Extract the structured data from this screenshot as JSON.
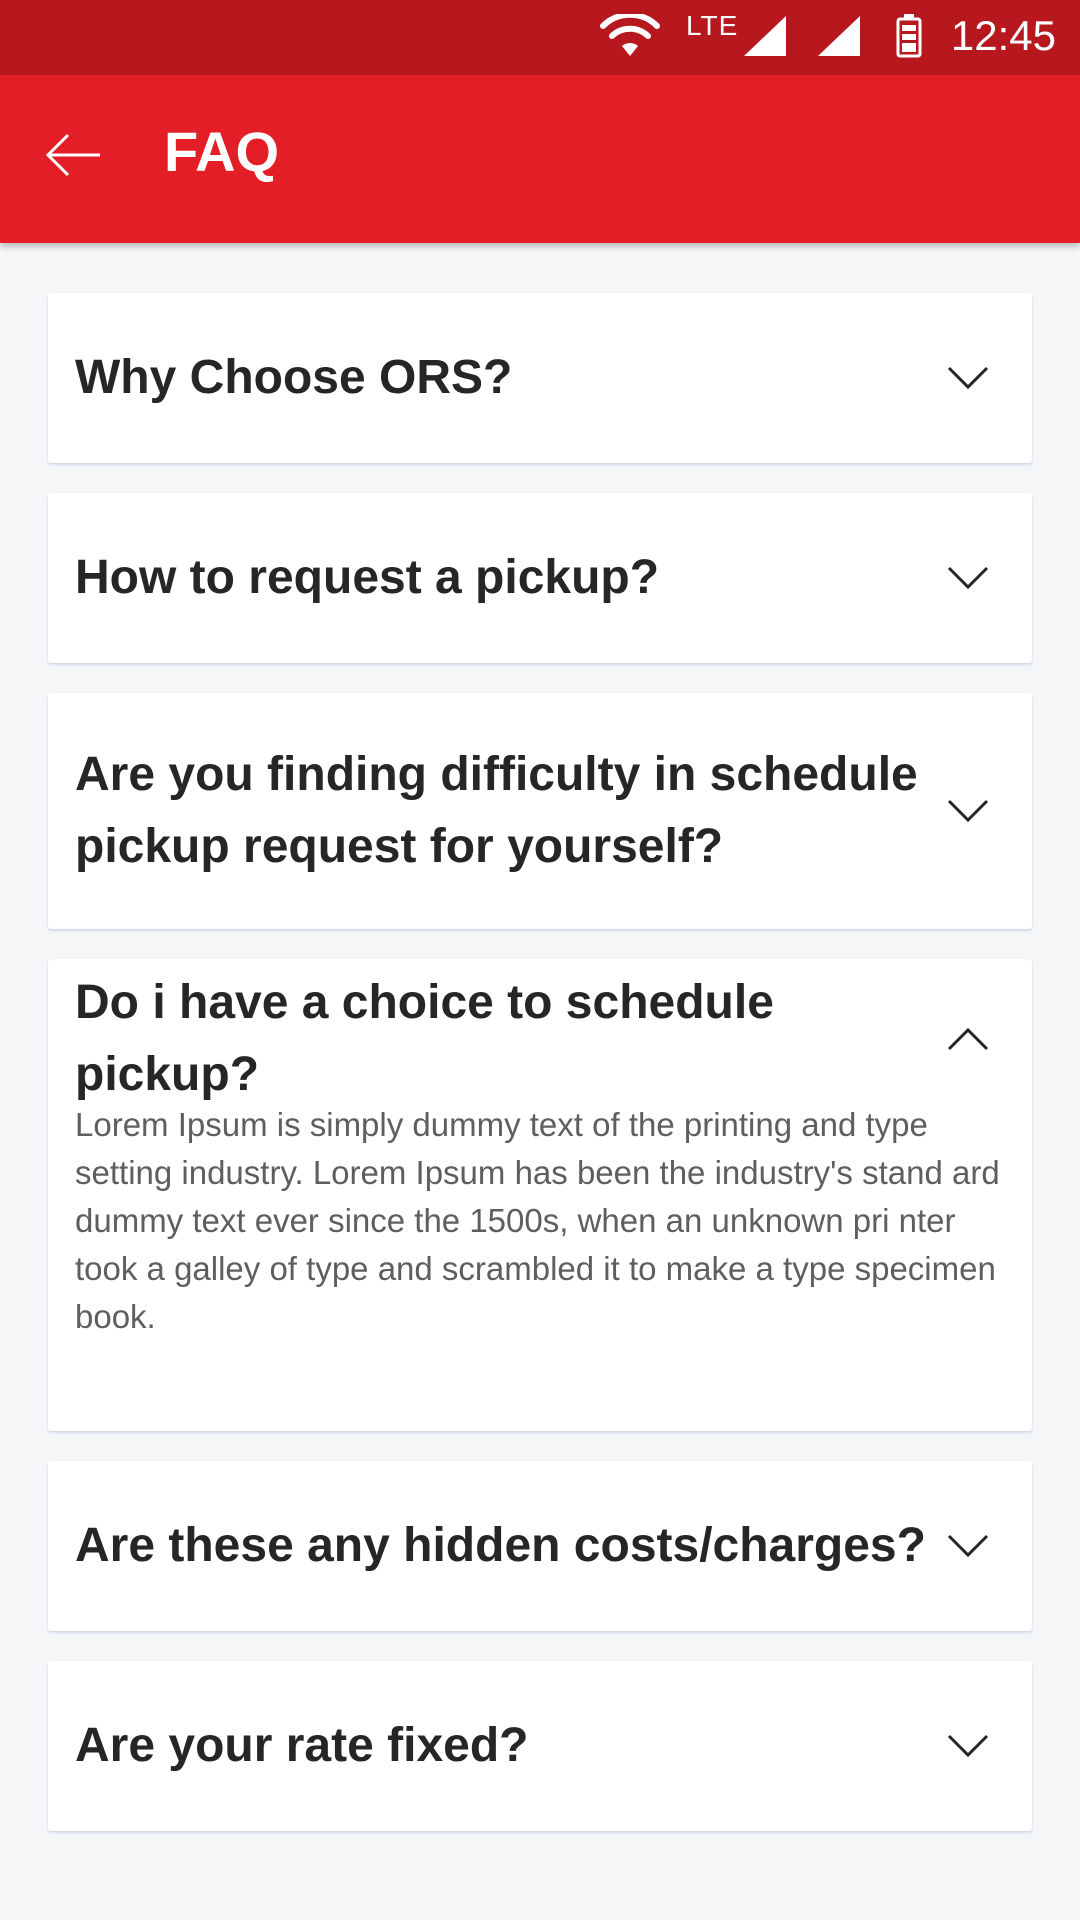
{
  "status_bar": {
    "network": "LTE",
    "time": "12:45",
    "icons": [
      "wifi-icon",
      "lte-signal-icon",
      "signal-icon",
      "battery-icon"
    ]
  },
  "app_bar": {
    "title": "FAQ",
    "back_icon": "arrow-left-icon"
  },
  "colors": {
    "status_bar": "#b7181e",
    "app_bar": "#e31e26",
    "background": "#f5f6f8",
    "card": "#ffffff",
    "question_text": "#262626",
    "answer_text": "#5e5e5e"
  },
  "faqs": [
    {
      "question": "Why Choose ORS?",
      "expanded": false
    },
    {
      "question": "How to request a pickup?",
      "expanded": false
    },
    {
      "question": "Are you finding difficulty in schedule pickup request for yourself?",
      "expanded": false
    },
    {
      "question": "Do i have a choice to schedule pickup?",
      "expanded": true,
      "answer": "Lorem Ipsum is simply dummy text of the printing and type setting industry. Lorem Ipsum has been the industry's stand ard dummy text ever since the 1500s, when an unknown pri nter took a galley of type and scrambled it to make a type specimen book."
    },
    {
      "question": "Are these any hidden costs/charges?",
      "expanded": false
    },
    {
      "question": "Are your rate fixed?",
      "expanded": false
    }
  ]
}
